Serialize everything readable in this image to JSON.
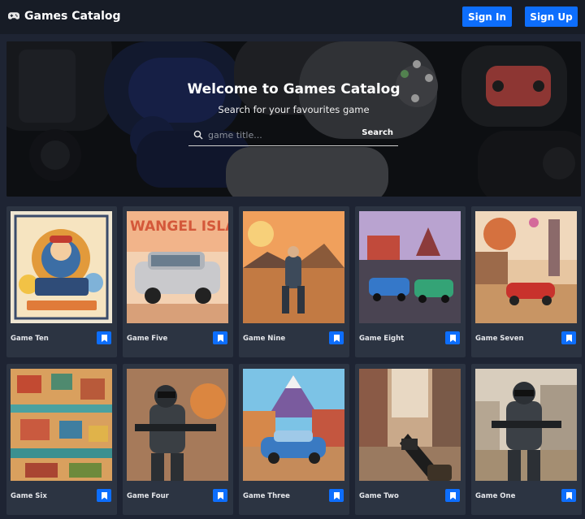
{
  "navbar": {
    "brand_icon": "gamepad-icon",
    "brand": "Games Catalog",
    "sign_in": "Sign In",
    "sign_up": "Sign Up",
    "accent": "#0d6efd"
  },
  "hero": {
    "title": "Welcome to Games Catalog",
    "subtitle": "Search for your favourites game",
    "search_placeholder": "game title...",
    "search_button": "Search",
    "search_icon": "search-icon"
  },
  "games": [
    {
      "title": "Game Ten",
      "icon": "bookmark-icon"
    },
    {
      "title": "Game Five",
      "icon": "bookmark-icon"
    },
    {
      "title": "Game Nine",
      "icon": "bookmark-icon"
    },
    {
      "title": "Game Eight",
      "icon": "bookmark-icon"
    },
    {
      "title": "Game Seven",
      "icon": "bookmark-icon"
    },
    {
      "title": "Game Six",
      "icon": "bookmark-icon"
    },
    {
      "title": "Game Four",
      "icon": "bookmark-icon"
    },
    {
      "title": "Game Three",
      "icon": "bookmark-icon"
    },
    {
      "title": "Game Two",
      "icon": "bookmark-icon"
    },
    {
      "title": "Game One",
      "icon": "bookmark-icon"
    }
  ],
  "cover_text": {
    "game_five": "WANGEL ISLAND"
  }
}
